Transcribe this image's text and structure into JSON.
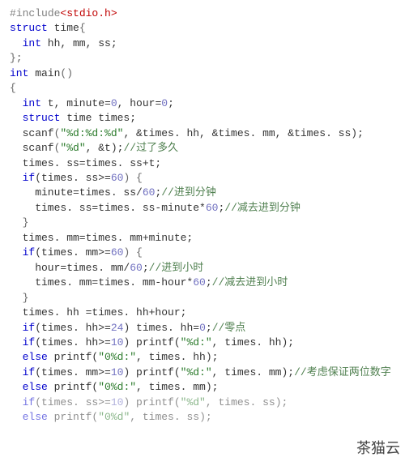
{
  "code": {
    "l1_sharp": "#",
    "l1_inc": "include",
    "l1_hdr": "<stdio.h>",
    "l2_struct": "struct",
    "l2_time": " time",
    "l2_brace": "{",
    "l3_type": "int",
    "l3_vars": " hh, mm, ss;",
    "l4": "};",
    "l5_type": "int",
    "l5_main": " main",
    "l5_p": "()",
    "l6": "{",
    "l7_type": "int",
    "l7_a": " t, minute",
    "l7_eq1": "=",
    "l7_z1": "0",
    "l7_b": ", hour",
    "l7_eq2": "=",
    "l7_z2": "0",
    "l7_c": ";",
    "l8_struct": "struct",
    "l8_rest": " time times;",
    "l9_scanf": "scanf",
    "l9_p1": "(",
    "l9_str": "\"%d:%d:%d\"",
    "l9_args": ", &times. hh, &times. mm, &times. ss)",
    "l9_end": ";",
    "l10_scanf": "scanf",
    "l10_p1": "(",
    "l10_str": "\"%d\"",
    "l10_args": ", &t)",
    "l10_end": ";",
    "l10_cmt": "//过了多久",
    "l11": "times. ss=times. ss+t;",
    "l12_if": "if",
    "l12_p": "(times. ss",
    "l12_ge": ">=",
    "l12_60": "60",
    "l12_pb": ") {",
    "l13_a": "minute=times. ss/",
    "l13_60": "60",
    "l13_b": ";",
    "l13_cmt": "//进到分钟",
    "l14_a": "times. ss=times. ss-minute*",
    "l14_60": "60",
    "l14_b": ";",
    "l14_cmt": "//减去进到分钟",
    "l15": "}",
    "l16": "times. mm=times. mm+minute;",
    "l17_if": "if",
    "l17_p": "(times. mm",
    "l17_ge": ">=",
    "l17_60": "60",
    "l17_pb": ") {",
    "l18_a": "hour=times. mm/",
    "l18_60": "60",
    "l18_b": ";",
    "l18_cmt": "//进到小时",
    "l19_a": "times. mm=times. mm-hour*",
    "l19_60": "60",
    "l19_b": ";",
    "l19_cmt": "//减去进到小时",
    "l20": "}",
    "l21": "times. hh =times. hh+hour;",
    "l22_if": "if",
    "l22_p": "(times. hh",
    "l22_ge": ">=",
    "l22_24": "24",
    "l22_a": ") times. hh=",
    "l22_z": "0",
    "l22_b": ";",
    "l22_cmt": "//零点",
    "l23_if": "if",
    "l23_p": "(times. hh",
    "l23_ge": ">=",
    "l23_10": "10",
    "l23_a": ") printf(",
    "l23_str": "\"%d:\"",
    "l23_b": ", times. hh);",
    "l24_else": "else",
    "l24_a": " printf(",
    "l24_str": "\"0%d:\"",
    "l24_b": ", times. hh);",
    "l25_if": "if",
    "l25_p": "(times. mm",
    "l25_ge": ">=",
    "l25_10": "10",
    "l25_a": ") printf(",
    "l25_str": "\"%d:\"",
    "l25_b": ", times. mm);",
    "l25_cmt": "//考虑保证两位数字",
    "l26_else": "else",
    "l26_a": " printf(",
    "l26_str": "\"0%d:\"",
    "l26_b": ", times. mm);",
    "l27_if": "if",
    "l27_p": "(times. ss",
    "l27_ge": ">=",
    "l27_10": "10",
    "l27_a": ") printf(",
    "l27_str": "\"%d\"",
    "l27_b": ", times. ss);",
    "l28_else": "else",
    "l28_a": " printf(",
    "l28_str": "\"0%d\"",
    "l28_b": ", times. ss);"
  },
  "watermark": "茶猫云"
}
